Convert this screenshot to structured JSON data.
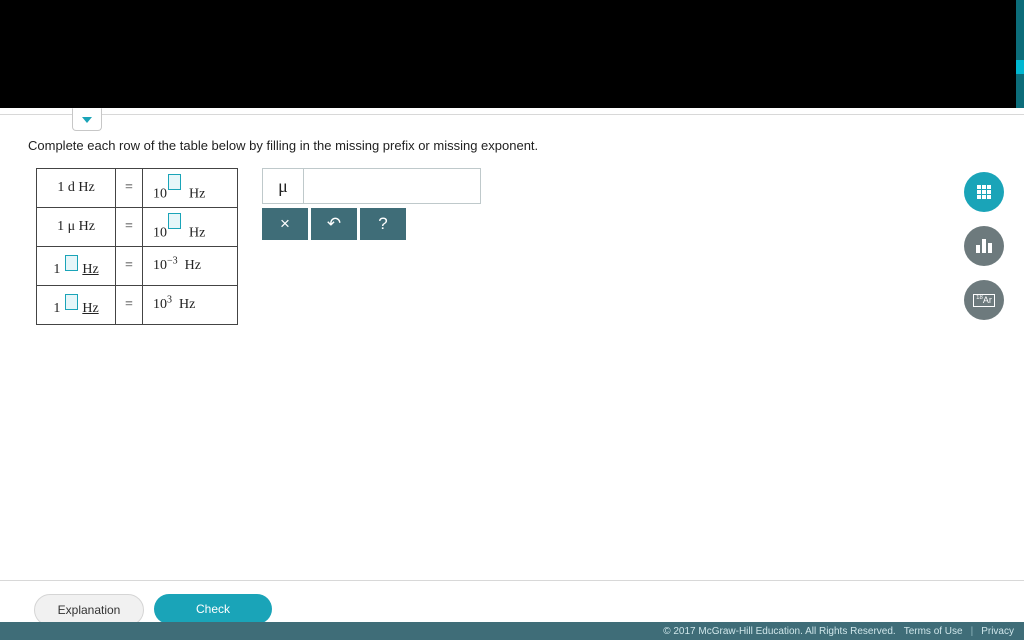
{
  "instruction": "Complete each row of the table below by filling in the missing prefix or missing exponent.",
  "table": {
    "rows": [
      {
        "lhs_num": "1",
        "lhs_prefix": "d",
        "lhs_prefix_is_input": false,
        "lhs_hl": false,
        "lhs_unit": "Hz",
        "rhs_base": "10",
        "rhs_exp": "",
        "rhs_exp_is_input": true,
        "rhs_unit": "Hz"
      },
      {
        "lhs_num": "1",
        "lhs_prefix": "μ",
        "lhs_prefix_is_input": false,
        "lhs_hl": false,
        "lhs_unit": "Hz",
        "rhs_base": "10",
        "rhs_exp": "",
        "rhs_exp_is_input": true,
        "rhs_unit": "Hz"
      },
      {
        "lhs_num": "1",
        "lhs_prefix": "",
        "lhs_prefix_is_input": true,
        "lhs_hl": true,
        "lhs_unit": "Hz",
        "rhs_base": "10",
        "rhs_exp": "−3",
        "rhs_exp_is_input": false,
        "rhs_unit": "Hz"
      },
      {
        "lhs_num": "1",
        "lhs_prefix": "",
        "lhs_prefix_is_input": true,
        "lhs_hl": true,
        "lhs_unit": "Hz",
        "rhs_base": "10",
        "rhs_exp": "3",
        "rhs_exp_is_input": false,
        "rhs_unit": "Hz"
      }
    ],
    "equals": "="
  },
  "palette": {
    "mu_symbol": "μ",
    "close": "×",
    "undo": "↶",
    "help": "?"
  },
  "buttons": {
    "explanation": "Explanation",
    "check": "Check"
  },
  "tools": {
    "calculator": "calculator",
    "bars": "bar-chart",
    "periodic": "Ar"
  },
  "footer": {
    "copyright": "© 2017 McGraw-Hill Education. All Rights Reserved.",
    "terms": "Terms of Use",
    "privacy": "Privacy"
  }
}
